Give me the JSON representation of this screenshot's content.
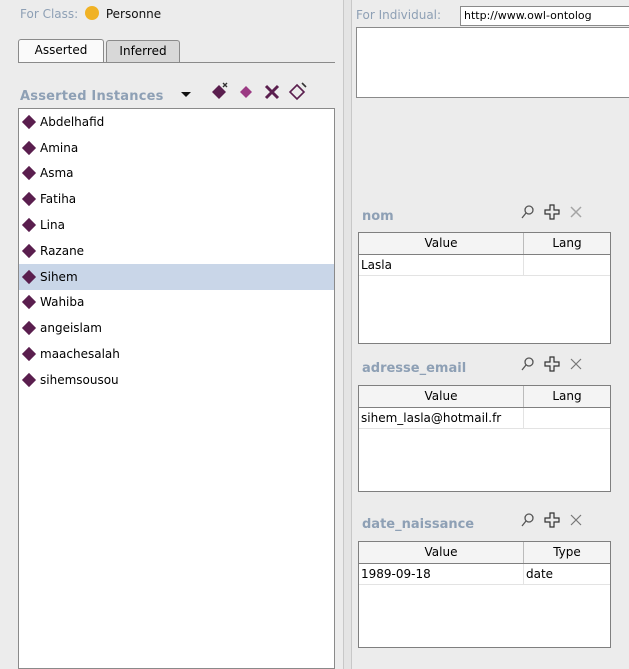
{
  "for_class": {
    "label": "For Class:",
    "value": "Personne"
  },
  "tabs": [
    {
      "label": "Asserted"
    },
    {
      "label": "Inferred"
    }
  ],
  "instances": {
    "title": "Asserted Instances",
    "items": [
      "Abdelhafid",
      "Amina",
      "Asma",
      "Fatiha",
      "Lina",
      "Razane",
      "Sihem",
      "Wahiba",
      "angeislam",
      "maachesalah",
      "sihemsousou"
    ],
    "selected": "Sihem"
  },
  "for_individual": {
    "label": "For Individual:",
    "uri": "http://www.owl-ontolog"
  },
  "properties": [
    {
      "name": "nom",
      "col1": "Value",
      "col2": "Lang",
      "rows": [
        [
          "Lasla",
          ""
        ]
      ]
    },
    {
      "name": "adresse_email",
      "col1": "Value",
      "col2": "Lang",
      "rows": [
        [
          "sihem_lasla@hotmail.fr",
          ""
        ]
      ]
    },
    {
      "name": "date_naissance",
      "col1": "Value",
      "col2": "Type",
      "rows": [
        [
          "1989-09-18",
          "date"
        ]
      ]
    }
  ],
  "colors": {
    "instance_gem": "#5a1e4e",
    "class_dot": "#f0b225",
    "selection": "#c9d6e8",
    "section_label": "#8ea0b5"
  }
}
